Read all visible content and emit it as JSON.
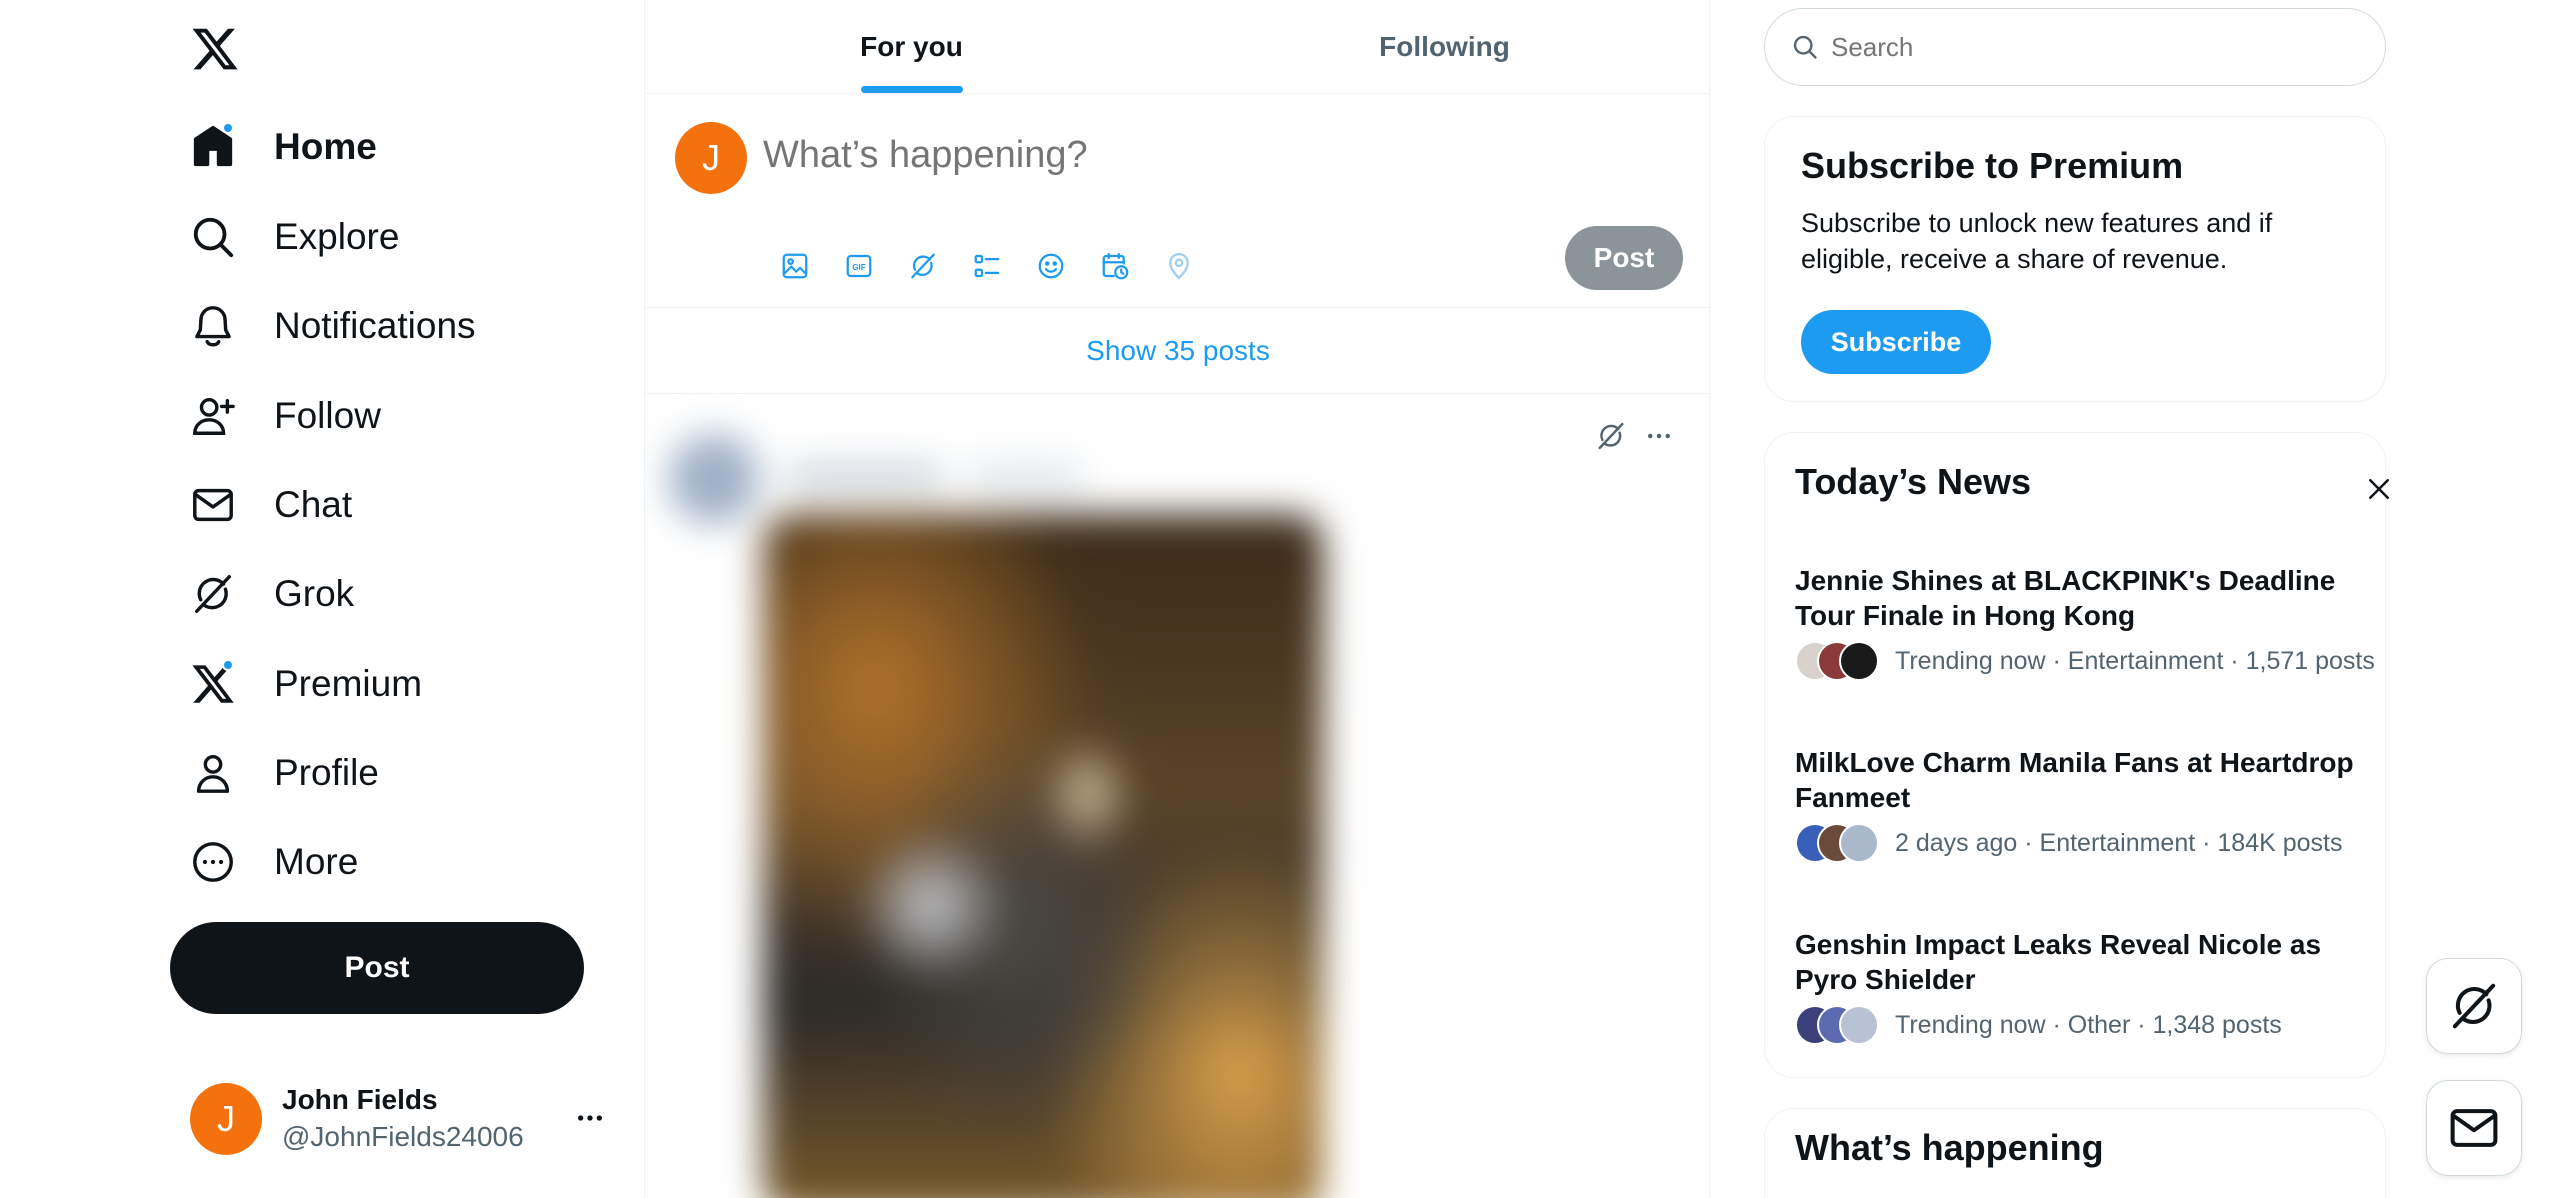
{
  "nav": {
    "items": [
      {
        "label": "Home",
        "icon": "home-icon"
      },
      {
        "label": "Explore",
        "icon": "search-icon"
      },
      {
        "label": "Notifications",
        "icon": "bell-icon"
      },
      {
        "label": "Follow",
        "icon": "follow-icon"
      },
      {
        "label": "Chat",
        "icon": "mail-icon"
      },
      {
        "label": "Grok",
        "icon": "grok-icon"
      },
      {
        "label": "Premium",
        "icon": "x-logo-icon"
      },
      {
        "label": "Profile",
        "icon": "profile-icon"
      },
      {
        "label": "More",
        "icon": "more-circle-icon"
      }
    ],
    "post_label": "Post"
  },
  "account": {
    "initial": "J",
    "name": "John Fields",
    "handle": "@JohnFields24006"
  },
  "tabs": [
    {
      "label": "For you",
      "active": true
    },
    {
      "label": "Following",
      "active": false
    }
  ],
  "composer": {
    "initial": "J",
    "placeholder": "What’s happening?",
    "post_label": "Post",
    "tools": [
      "image-icon",
      "gif-icon",
      "grok-icon",
      "poll-icon",
      "emoji-icon",
      "schedule-icon",
      "location-icon"
    ]
  },
  "feed": {
    "show_posts": "Show 35 posts"
  },
  "search": {
    "placeholder": "Search"
  },
  "premium": {
    "title": "Subscribe to Premium",
    "description": "Subscribe to unlock new features and if eligible, receive a share of revenue.",
    "button": "Subscribe"
  },
  "news": {
    "title": "Today’s News",
    "items": [
      {
        "headline": "Jennie Shines at BLACKPINK's Deadline Tour Finale in Hong Kong",
        "meta": "Trending now · Entertainment · 1,571 posts"
      },
      {
        "headline": "MilkLove Charm Manila Fans at Heartdrop Fanmeet",
        "meta": "2 days ago · Entertainment · 184K posts"
      },
      {
        "headline": "Genshin Impact Leaks Reveal Nicole as Pyro Shielder",
        "meta": "Trending now · Other · 1,348 posts"
      }
    ]
  },
  "happening": {
    "title": "What’s happening"
  },
  "colors": {
    "accent": "#1d9bf0",
    "avatar": "#f4720d",
    "text": "#0f1419",
    "muted": "#536471"
  }
}
